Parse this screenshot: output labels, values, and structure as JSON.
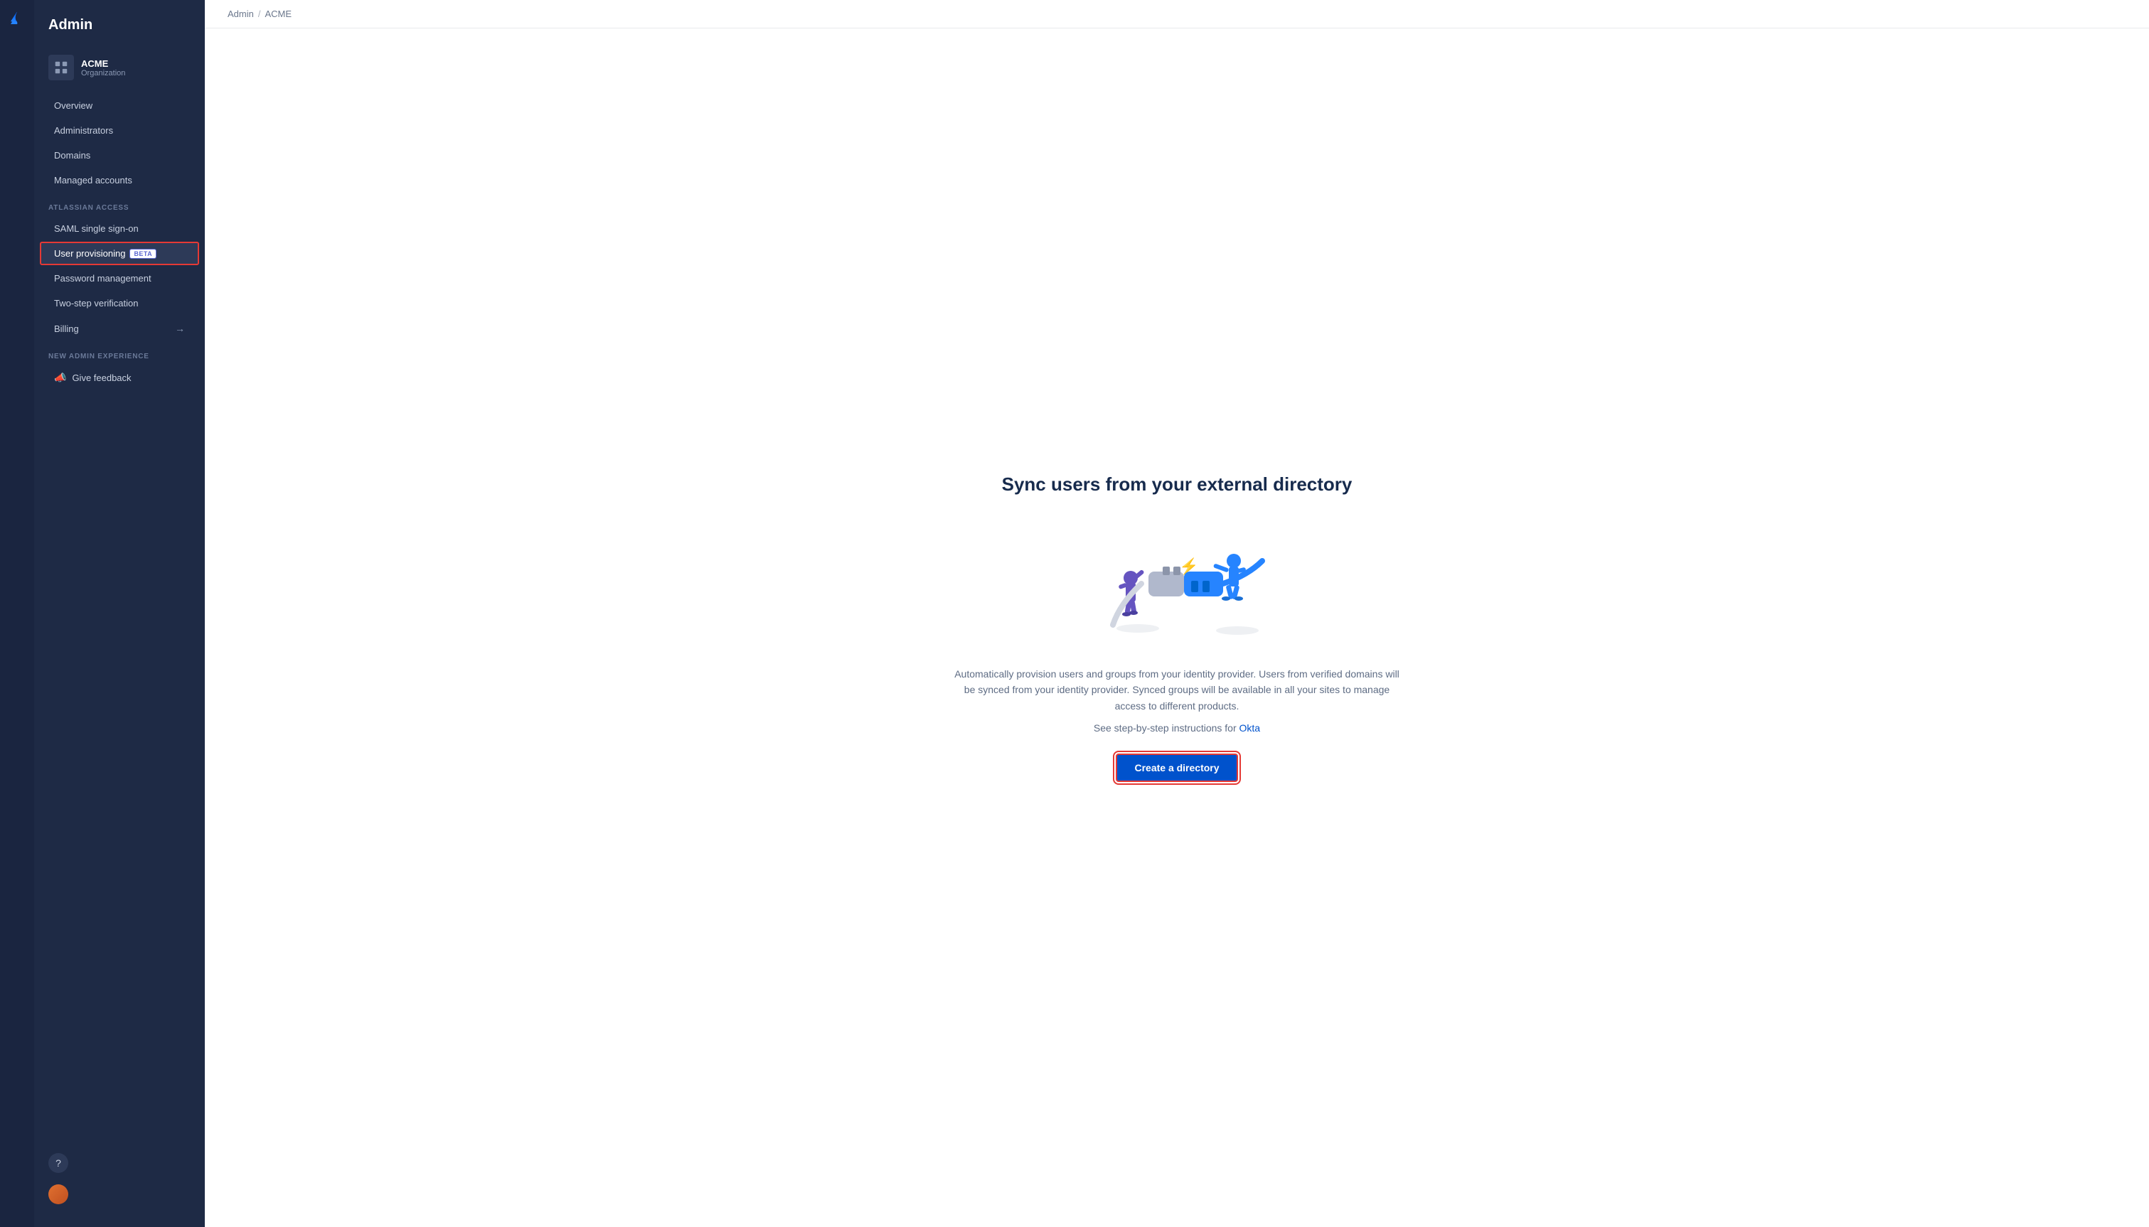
{
  "app": {
    "title": "Admin",
    "logo_label": "Atlassian logo"
  },
  "breadcrumb": {
    "admin": "Admin",
    "separator": "/",
    "current": "ACME"
  },
  "org": {
    "name": "ACME",
    "subtitle": "Organization"
  },
  "sidebar": {
    "overview": "Overview",
    "administrators": "Administrators",
    "domains": "Domains",
    "managed_accounts": "Managed accounts",
    "section_atlassian_access": "ATLASSIAN ACCESS",
    "saml_sso": "SAML single sign-on",
    "user_provisioning": "User provisioning",
    "beta_badge": "BETA",
    "password_management": "Password management",
    "two_step_verification": "Two-step verification",
    "billing": "Billing",
    "section_new_admin": "NEW ADMIN EXPERIENCE",
    "give_feedback": "Give feedback"
  },
  "main": {
    "heading": "Sync users from your external directory",
    "description": "Automatically provision users and groups from your identity provider. Users from verified domains will be synced from your identity provider. Synced groups will be available in all your sites to manage access to different products.",
    "step_instruction_prefix": "See step-by-step instructions for",
    "step_instruction_link": "Okta",
    "create_button": "Create a directory"
  }
}
